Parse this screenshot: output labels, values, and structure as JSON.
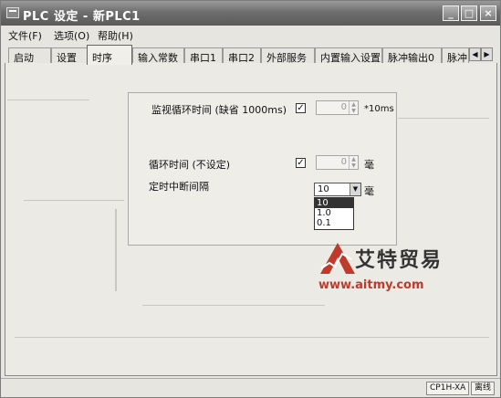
{
  "window": {
    "title": "PLC 设定 - 新PLC1",
    "controls": [
      "_",
      "□",
      "×"
    ]
  },
  "menu": {
    "items": [
      "文件(F)",
      "选项(O)",
      "帮助(H)"
    ]
  },
  "tabs": [
    {
      "label": "启动",
      "active": false
    },
    {
      "label": "设置",
      "active": false
    },
    {
      "label": "时序",
      "active": true
    },
    {
      "label": "输入常数",
      "active": false
    },
    {
      "label": "串口1",
      "active": false
    },
    {
      "label": "串口2",
      "active": false
    },
    {
      "label": "外部服务",
      "active": false
    },
    {
      "label": "内置输入设置",
      "active": false
    },
    {
      "label": "脉冲输出0",
      "active": false
    },
    {
      "label": "脉冲",
      "active": false
    }
  ],
  "tab_scroll": {
    "left": "◀",
    "right": "▶"
  },
  "timing": {
    "watch_cycle": {
      "label": "监视循环时间 (缺省 1000ms)",
      "checked": true,
      "value": "0",
      "unit": "*10ms"
    },
    "cycle_time": {
      "label": "循环时间 (不设定)",
      "checked": true,
      "value": "0",
      "unit": "毫"
    },
    "interrupt_interval": {
      "label": "定时中断间隔",
      "selected": "10",
      "unit": "毫",
      "options": [
        "10",
        "1.0",
        "0.1"
      ]
    }
  },
  "watermark": {
    "brand": "艾特贸易",
    "url": "www.aitmy.com"
  },
  "status": {
    "model": "CP1H-XA",
    "mode": "离线"
  }
}
